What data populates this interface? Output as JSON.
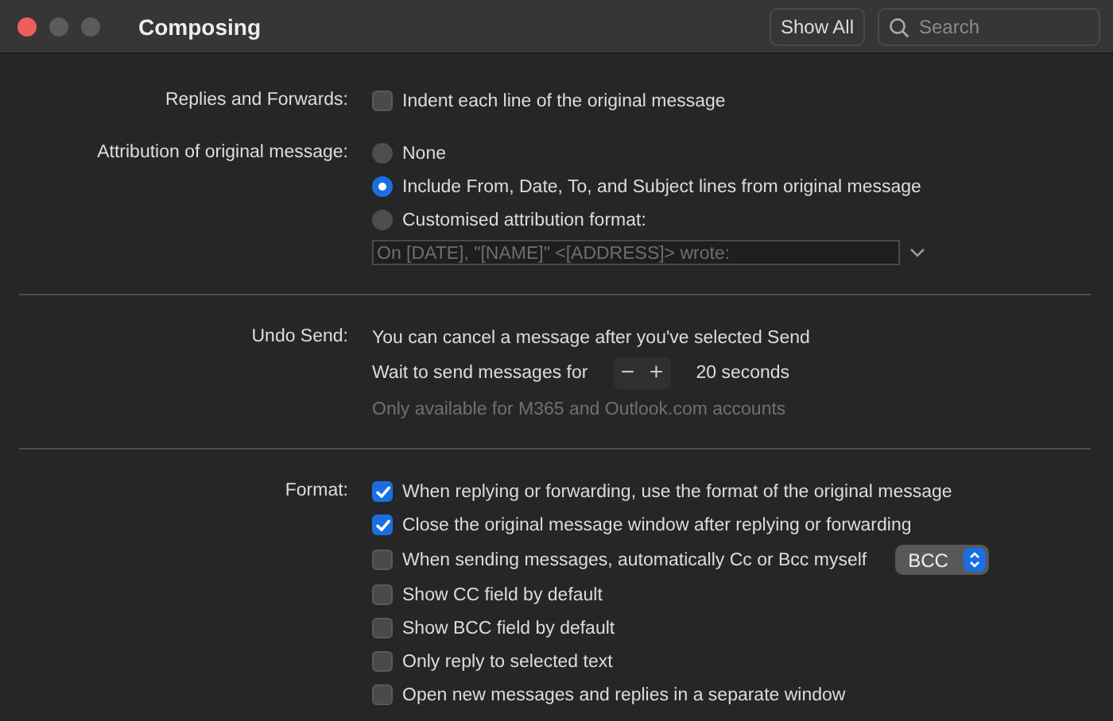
{
  "window": {
    "title": "Composing",
    "show_all": "Show All",
    "search": {
      "placeholder": "Search"
    }
  },
  "sections": [
    {
      "groups": [
        {
          "label": "Replies and Forwards:",
          "items": [
            {
              "kind": "checkbox",
              "text": "Indent each line of the original message",
              "checked": false
            }
          ]
        },
        {
          "label": "Attribution of original message:",
          "items": [
            {
              "kind": "radio",
              "text": "None",
              "selected": false
            },
            {
              "kind": "radio",
              "text": "Include From, Date, To, and Subject lines from original message",
              "selected": true
            },
            {
              "kind": "radio",
              "text": "Customised attribution format:",
              "selected": false
            },
            {
              "kind": "combo",
              "value": "On [DATE], \"[NAME]\" <[ADDRESS]> wrote:",
              "disabled": true
            }
          ]
        }
      ]
    },
    {
      "groups": [
        {
          "label": "Undo Send:",
          "items": [
            {
              "kind": "text",
              "text": "You can cancel a message after you've selected Send"
            },
            {
              "kind": "stepper",
              "text": "Wait to send messages for",
              "minus": "−",
              "plus": "+",
              "value": "20 seconds"
            },
            {
              "kind": "note",
              "text": "Only available for M365 and Outlook.com accounts"
            }
          ]
        }
      ]
    },
    {
      "groups": [
        {
          "label": "Format:",
          "items": [
            {
              "kind": "checkbox",
              "text": "When replying or forwarding, use the format of the original message",
              "checked": true
            },
            {
              "kind": "checkbox",
              "text": "Close the original message window after replying or forwarding",
              "checked": true
            },
            {
              "kind": "checkbox",
              "text": "When sending messages, automatically Cc or Bcc myself",
              "checked": false,
              "popup": "BCC"
            },
            {
              "kind": "checkbox",
              "text": "Show CC field by default",
              "checked": false
            },
            {
              "kind": "checkbox",
              "text": "Show BCC field by default",
              "checked": false
            },
            {
              "kind": "checkbox",
              "text": "Only reply to selected text",
              "checked": false
            },
            {
              "kind": "checkbox",
              "text": "Open new messages and replies in a separate window",
              "checked": false
            }
          ]
        }
      ]
    }
  ]
}
